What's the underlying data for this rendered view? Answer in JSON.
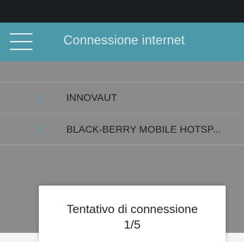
{
  "app_bar": {
    "title": "Connessione internet",
    "menu_icon": "hamburger-menu-icon",
    "background_color": "#4c9aa9"
  },
  "networks": [
    {
      "name": "INNOVAUT",
      "icon": "chevron-right-icon"
    },
    {
      "name": "BLACK-BERRY MOBILE HOTSP...",
      "icon": "chevron-right-icon"
    }
  ],
  "dialog": {
    "message": "Tentativo di connessione",
    "progress": "1/5"
  },
  "colors": {
    "status_bar": "#1c1f21",
    "overlay": "#8b8b8b",
    "chevron": "#5aa7b5"
  }
}
